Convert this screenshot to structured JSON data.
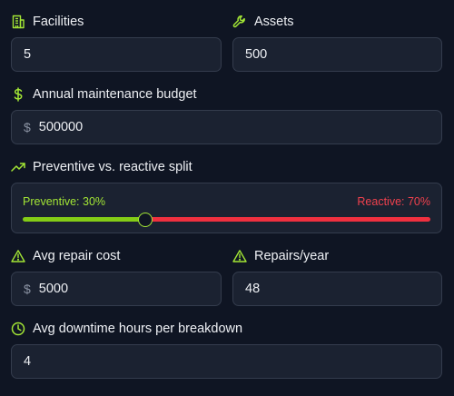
{
  "colors": {
    "accent": "#a3e635",
    "preventive": "#84cc16",
    "reactive": "#f0303f",
    "background": "#0f1523",
    "input_bg": "#1b2231"
  },
  "facilities": {
    "label": "Facilities",
    "value": "5",
    "icon": "building-icon"
  },
  "assets": {
    "label": "Assets",
    "value": "500",
    "icon": "wrench-icon"
  },
  "budget": {
    "label": "Annual maintenance budget",
    "prefix": "$",
    "value": "500000",
    "icon": "dollar-icon"
  },
  "split": {
    "label": "Preventive vs. reactive split",
    "icon": "trending-up-icon",
    "preventive_label": "Preventive: 30%",
    "reactive_label": "Reactive: 70%",
    "preventive_percent": 30
  },
  "repair_cost": {
    "label": "Avg repair cost",
    "prefix": "$",
    "value": "5000",
    "icon": "warning-icon"
  },
  "repairs_year": {
    "label": "Repairs/year",
    "value": "48",
    "icon": "warning-icon"
  },
  "downtime": {
    "label": "Avg downtime hours per breakdown",
    "value": "4",
    "icon": "clock-icon"
  }
}
